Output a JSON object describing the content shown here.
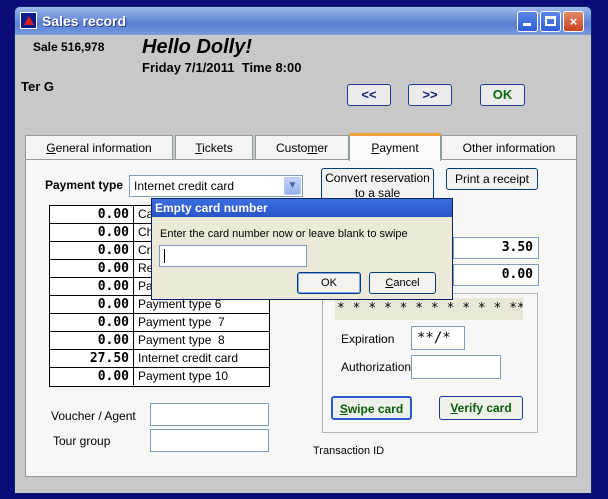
{
  "window": {
    "title": "Sales record",
    "app_icon": "app-logo-icon",
    "controls": {
      "minimize": "minimize-icon",
      "maximize": "maximize-icon",
      "close": "×"
    }
  },
  "header": {
    "sale_number": "Sale 516,978",
    "greeting": "Hello Dolly!",
    "datetime": "Friday 7/1/2011  Time 8:00",
    "user": "Ter G"
  },
  "nav": {
    "prev": "<<",
    "next": ">>",
    "ok": "OK"
  },
  "tabs": [
    {
      "pre": "",
      "u": "G",
      "post": "eneral information"
    },
    {
      "pre": "",
      "u": "T",
      "post": "ickets"
    },
    {
      "pre": "Custo",
      "u": "m",
      "post": "er"
    },
    {
      "pre": "",
      "u": "P",
      "post": "ayment"
    },
    {
      "pre": "Other information",
      "u": "",
      "post": ""
    }
  ],
  "payment": {
    "type_label": "Payment type",
    "type_value": "Internet credit card",
    "rows": [
      {
        "amount": "0.00",
        "name": "Ca"
      },
      {
        "amount": "0.00",
        "name": "Ch"
      },
      {
        "amount": "0.00",
        "name": "Cr"
      },
      {
        "amount": "0.00",
        "name": "Re"
      },
      {
        "amount": "0.00",
        "name": "Pa"
      },
      {
        "amount": "0.00",
        "name": "Payment type 6"
      },
      {
        "amount": "0.00",
        "name": "Payment type  7"
      },
      {
        "amount": "0.00",
        "name": "Payment type  8"
      },
      {
        "amount": "27.50",
        "name": "Internet credit card"
      },
      {
        "amount": "0.00",
        "name": "Payment type 10"
      }
    ],
    "voucher_label": "Voucher / Agent",
    "tour_label": "Tour group",
    "convert_label_1": "Convert reservation",
    "convert_label_2": "to a sale",
    "print_label": "Print a receipt",
    "amount_1": "3.50",
    "amount_2": "0.00",
    "card_mask": "* * * *  * * * *  * * * *****",
    "expiration_label": "Expiration",
    "expiration_value": "**/*",
    "authorization_label": "Authorization",
    "swipe_u": "S",
    "swipe_rest": "wipe card",
    "verify_u": "V",
    "verify_rest": "erify card",
    "transaction_label": "Transaction ID"
  },
  "dialog": {
    "title": "Empty card number",
    "message": "Enter the card number now or leave blank to swipe",
    "ok": "OK",
    "cancel_u": "C",
    "cancel_rest": "ancel"
  }
}
